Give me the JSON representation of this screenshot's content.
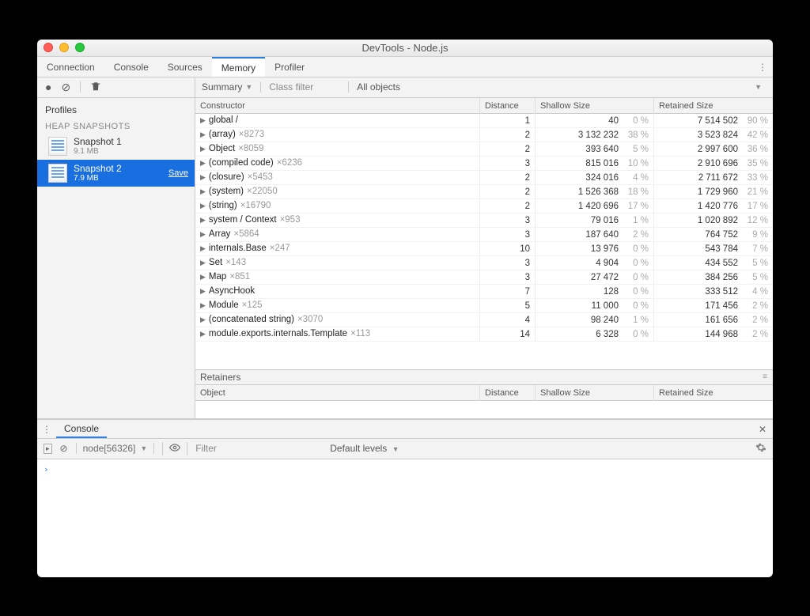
{
  "window": {
    "title": "DevTools - Node.js"
  },
  "tabs": {
    "items": [
      "Connection",
      "Console",
      "Sources",
      "Memory",
      "Profiler"
    ],
    "active_index": 3
  },
  "sidebar": {
    "profiles_label": "Profiles",
    "section_label": "HEAP SNAPSHOTS",
    "snapshots": [
      {
        "name": "Snapshot 1",
        "size": "9.1 MB",
        "selected": false,
        "save": ""
      },
      {
        "name": "Snapshot 2",
        "size": "7.9 MB",
        "selected": true,
        "save": "Save"
      }
    ]
  },
  "toolbar": {
    "view": "Summary",
    "filter_placeholder": "Class filter",
    "scope": "All objects"
  },
  "columns": {
    "constructor": "Constructor",
    "distance": "Distance",
    "shallow": "Shallow Size",
    "retained": "Retained Size"
  },
  "rows": [
    {
      "name": "global /",
      "count": "",
      "dist": 1,
      "shallow": "40",
      "shallow_pct": "0 %",
      "retained": "7 514 502",
      "retained_pct": "90 %"
    },
    {
      "name": "(array)",
      "count": "×8273",
      "dist": 2,
      "shallow": "3 132 232",
      "shallow_pct": "38 %",
      "retained": "3 523 824",
      "retained_pct": "42 %"
    },
    {
      "name": "Object",
      "count": "×8059",
      "dist": 2,
      "shallow": "393 640",
      "shallow_pct": "5 %",
      "retained": "2 997 600",
      "retained_pct": "36 %"
    },
    {
      "name": "(compiled code)",
      "count": "×6236",
      "dist": 3,
      "shallow": "815 016",
      "shallow_pct": "10 %",
      "retained": "2 910 696",
      "retained_pct": "35 %"
    },
    {
      "name": "(closure)",
      "count": "×5453",
      "dist": 2,
      "shallow": "324 016",
      "shallow_pct": "4 %",
      "retained": "2 711 672",
      "retained_pct": "33 %"
    },
    {
      "name": "(system)",
      "count": "×22050",
      "dist": 2,
      "shallow": "1 526 368",
      "shallow_pct": "18 %",
      "retained": "1 729 960",
      "retained_pct": "21 %"
    },
    {
      "name": "(string)",
      "count": "×16790",
      "dist": 2,
      "shallow": "1 420 696",
      "shallow_pct": "17 %",
      "retained": "1 420 776",
      "retained_pct": "17 %"
    },
    {
      "name": "system / Context",
      "count": "×953",
      "dist": 3,
      "shallow": "79 016",
      "shallow_pct": "1 %",
      "retained": "1 020 892",
      "retained_pct": "12 %"
    },
    {
      "name": "Array",
      "count": "×5864",
      "dist": 3,
      "shallow": "187 640",
      "shallow_pct": "2 %",
      "retained": "764 752",
      "retained_pct": "9 %"
    },
    {
      "name": "internals.Base",
      "count": "×247",
      "dist": 10,
      "shallow": "13 976",
      "shallow_pct": "0 %",
      "retained": "543 784",
      "retained_pct": "7 %"
    },
    {
      "name": "Set",
      "count": "×143",
      "dist": 3,
      "shallow": "4 904",
      "shallow_pct": "0 %",
      "retained": "434 552",
      "retained_pct": "5 %"
    },
    {
      "name": "Map",
      "count": "×851",
      "dist": 3,
      "shallow": "27 472",
      "shallow_pct": "0 %",
      "retained": "384 256",
      "retained_pct": "5 %"
    },
    {
      "name": "AsyncHook",
      "count": "",
      "dist": 7,
      "shallow": "128",
      "shallow_pct": "0 %",
      "retained": "333 512",
      "retained_pct": "4 %"
    },
    {
      "name": "Module",
      "count": "×125",
      "dist": 5,
      "shallow": "11 000",
      "shallow_pct": "0 %",
      "retained": "171 456",
      "retained_pct": "2 %"
    },
    {
      "name": "(concatenated string)",
      "count": "×3070",
      "dist": 4,
      "shallow": "98 240",
      "shallow_pct": "1 %",
      "retained": "161 656",
      "retained_pct": "2 %"
    },
    {
      "name": "module.exports.internals.Template",
      "count": "×113",
      "dist": 14,
      "shallow": "6 328",
      "shallow_pct": "0 %",
      "retained": "144 968",
      "retained_pct": "2 %"
    }
  ],
  "retainers": {
    "header": "Retainers",
    "object_label": "Object"
  },
  "drawer": {
    "tab": "Console",
    "context": "node[56326]",
    "filter_placeholder": "Filter",
    "levels": "Default levels",
    "prompt": "›"
  }
}
